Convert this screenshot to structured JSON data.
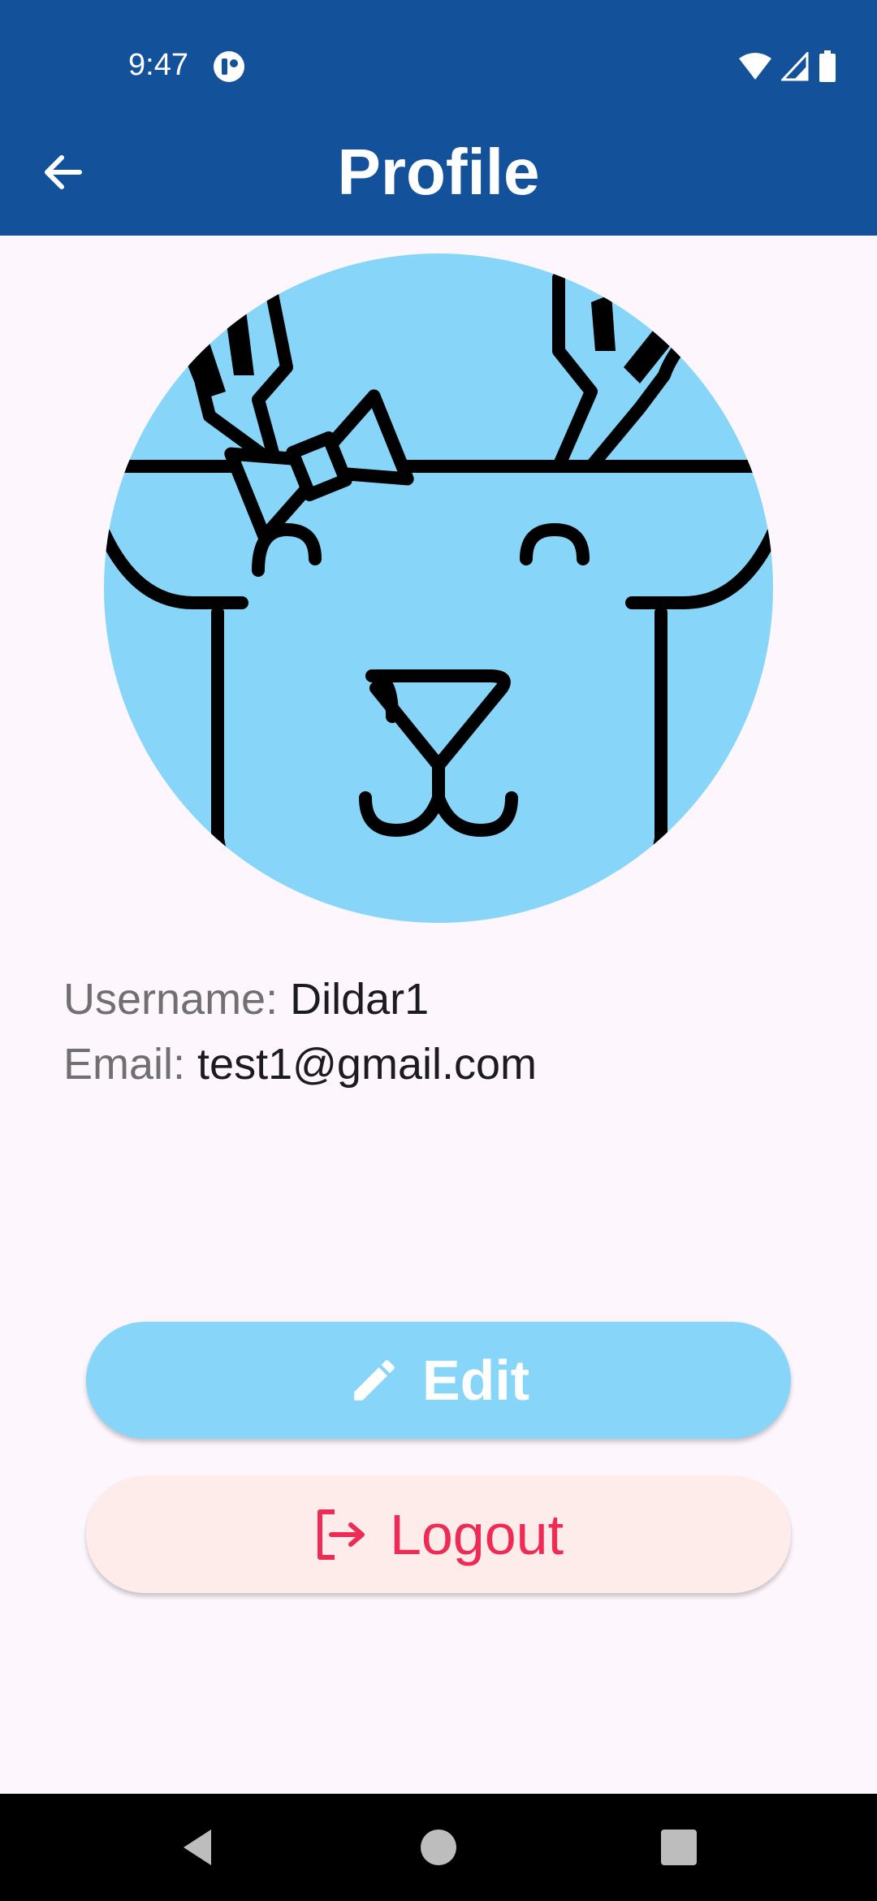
{
  "status_bar": {
    "time": "9:47",
    "icons": [
      "app-notification-icon",
      "wifi-icon",
      "signal-icon",
      "battery-icon"
    ]
  },
  "header": {
    "title": "Profile",
    "back_icon": "back-arrow-icon",
    "background": "#13519b"
  },
  "profile": {
    "avatar": "deer-avatar",
    "username_label": "Username:",
    "username": "Dildar1",
    "email_label": "Email:",
    "email": "test1@gmail.com"
  },
  "buttons": {
    "edit_label": "Edit",
    "edit_icon": "pencil-icon",
    "edit_color": "#87d6fa",
    "logout_label": "Logout",
    "logout_icon": "logout-icon",
    "logout_color": "#ee2b54"
  },
  "nav_bar": {
    "icons": [
      "back-triangle-icon",
      "home-circle-icon",
      "recents-square-icon"
    ]
  }
}
